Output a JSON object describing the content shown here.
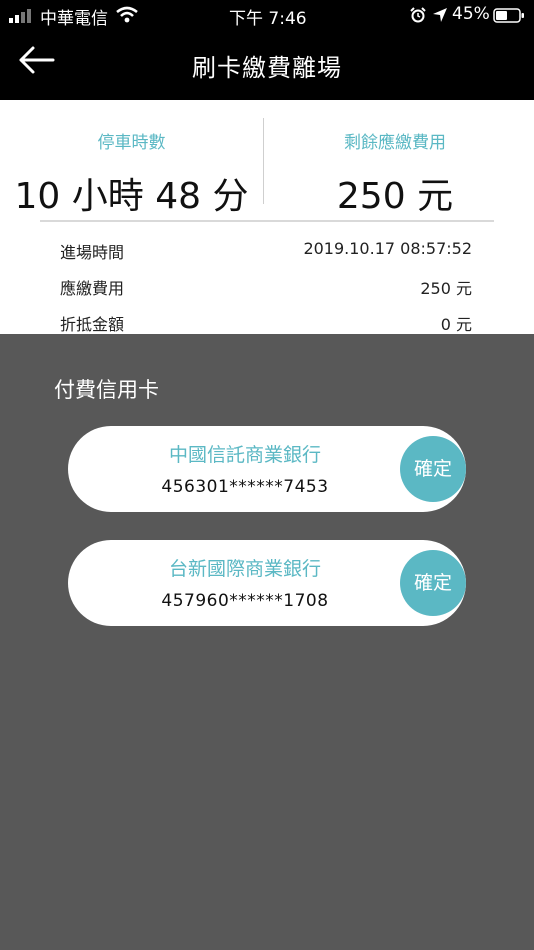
{
  "status_bar": {
    "carrier": "中華電信",
    "time": "下午 7:46",
    "battery": "45%",
    "icons": [
      "signal-icon",
      "wifi-icon",
      "alarm-icon",
      "location-arrow-icon",
      "battery-icon"
    ]
  },
  "nav": {
    "title": "刷卡繳費離場",
    "back_icon": "arrow-left-icon"
  },
  "summary": {
    "duration_label": "停車時數",
    "duration_value": "10 小時 48 分",
    "fee_label": "剩餘應繳費用",
    "fee_value": "250 元",
    "details": [
      {
        "label": "進場時間",
        "value": "2019.10.17 08:57:52"
      },
      {
        "label": "應繳費用",
        "value": "250 元"
      },
      {
        "label": "折抵金額",
        "value": "0 元"
      }
    ]
  },
  "cards_section": {
    "title": "付費信用卡",
    "cards": [
      {
        "bank": "中國信託商業銀行",
        "number": "456301******7453",
        "confirm": "確定"
      },
      {
        "bank": "台新國際商業銀行",
        "number": "457960******1708",
        "confirm": "確定"
      }
    ]
  },
  "colors": {
    "accent": "#5bb8c4",
    "overlay": "#585858",
    "header": "#000000"
  }
}
